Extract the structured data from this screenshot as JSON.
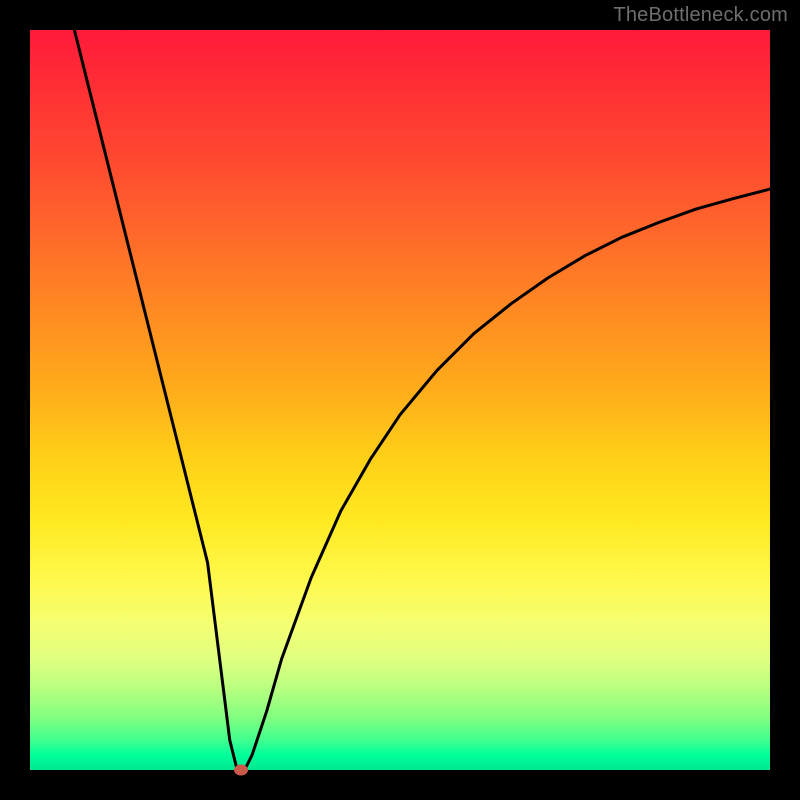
{
  "watermark": "TheBottleneck.com",
  "chart_data": {
    "type": "line",
    "title": "",
    "xlabel": "",
    "ylabel": "",
    "xlim": [
      0,
      100
    ],
    "ylim": [
      0,
      100
    ],
    "grid": false,
    "legend": false,
    "background_gradient": [
      "#ff1a3a",
      "#ff6a2a",
      "#ffd018",
      "#fff84a",
      "#00ff9a"
    ],
    "series": [
      {
        "name": "bottleneck-curve",
        "color": "#000000",
        "x": [
          6,
          8,
          10,
          12,
          14,
          16,
          18,
          20,
          22,
          24,
          25,
          26,
          27,
          28,
          29,
          30,
          32,
          34,
          38,
          42,
          46,
          50,
          55,
          60,
          65,
          70,
          75,
          80,
          85,
          90,
          95,
          100
        ],
        "y": [
          100,
          92,
          84,
          76,
          68,
          60,
          52,
          44,
          36,
          28,
          20,
          12,
          4,
          0,
          0,
          2,
          8,
          15,
          26,
          35,
          42,
          48,
          54,
          59,
          63,
          66.5,
          69.5,
          72,
          74,
          75.8,
          77.2,
          78.5
        ]
      }
    ],
    "annotations": [
      {
        "name": "minimum-marker",
        "x": 28.5,
        "y": 0,
        "color": "#cc5a4a"
      }
    ]
  }
}
